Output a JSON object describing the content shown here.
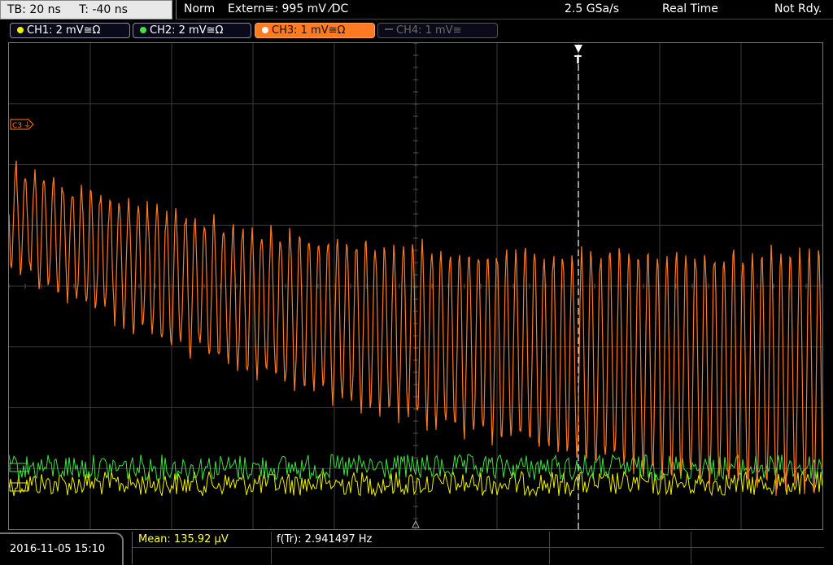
{
  "status": {
    "timebase": "TB: 20 ns",
    "trigger_time": "T: -40 ns",
    "mode": "Norm",
    "trigger_source": "Extern≅: 995 mV ⁄DC",
    "sample_rate": "2.5 GSa/s",
    "acq_mode": "Real Time",
    "state": "Not Rdy."
  },
  "channels": [
    {
      "label": "CH1: 2 mV≅Ω",
      "color": "#f0f000",
      "active": false,
      "enabled": true
    },
    {
      "label": "CH2: 2 mV≅Ω",
      "color": "#40e040",
      "active": false,
      "enabled": true
    },
    {
      "label": "CH3: 1 mV≅Ω",
      "color": "#ff7a20",
      "active": true,
      "enabled": true
    },
    {
      "label": "CH4: 1 mV≅",
      "color": "#666666",
      "active": false,
      "enabled": false
    }
  ],
  "markers": {
    "ch3": "C3",
    "trigger": "T"
  },
  "measurements": {
    "mean": "Mean: 135.92 µV",
    "freq": "f(Tr): 2.941497 Hz"
  },
  "datetime": "2016-11-05 15:10",
  "colors": {
    "ch1": "#f0f000",
    "ch2": "#40e040",
    "ch3": "#ff7a20",
    "grid": "#3a3a3a"
  }
}
